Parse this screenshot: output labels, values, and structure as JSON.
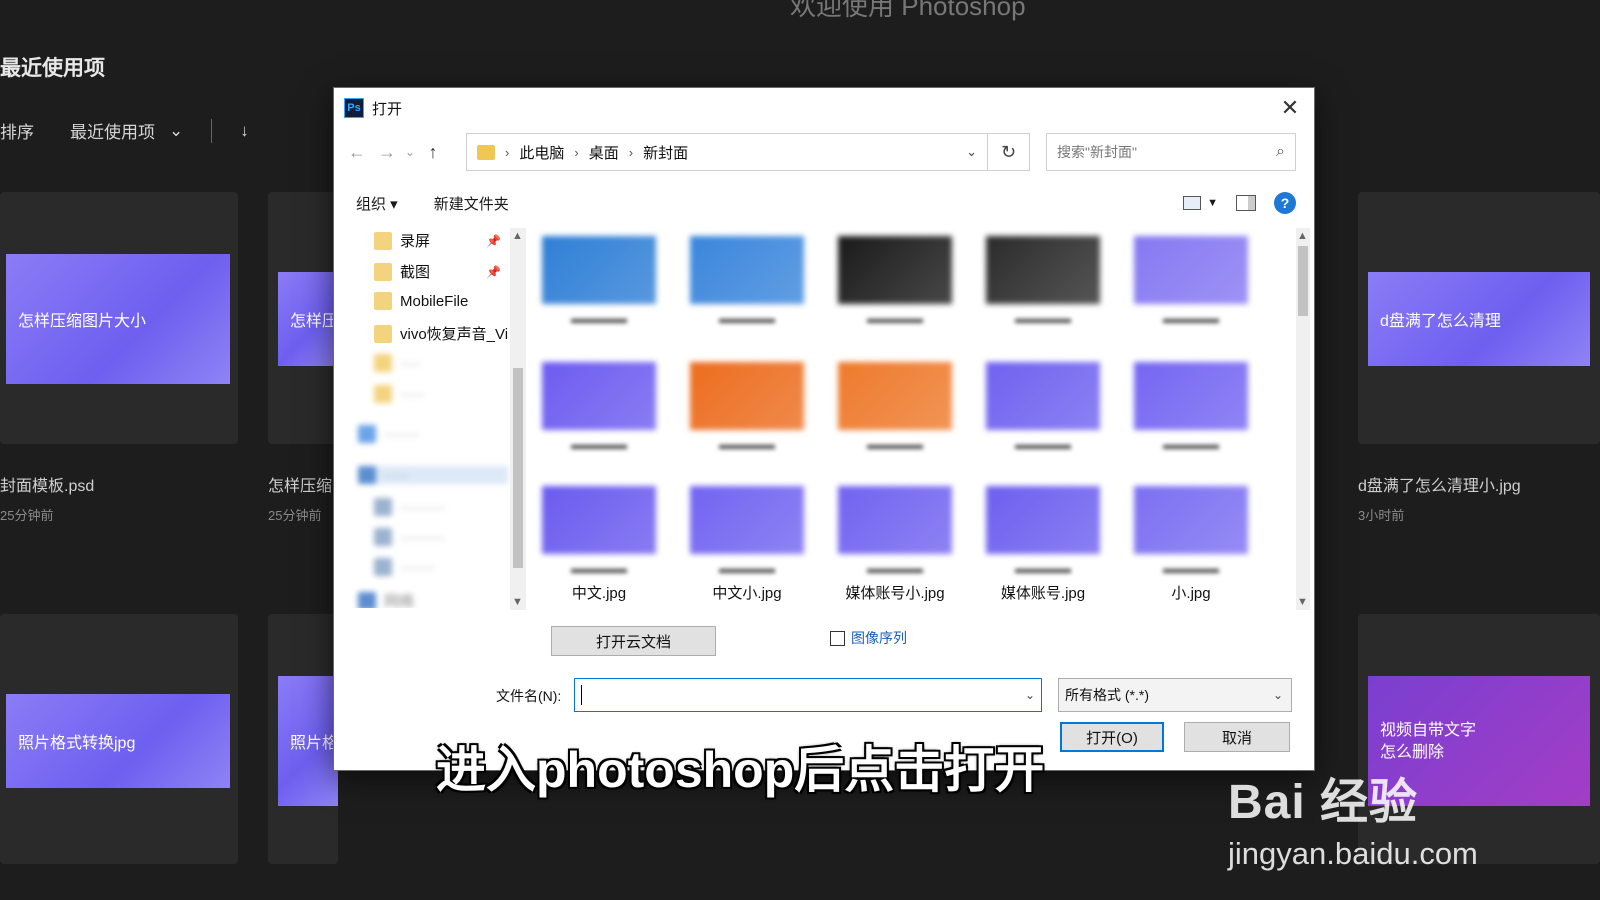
{
  "background": {
    "top_title": "欢迎使用 Photoshop",
    "section_title": "最近使用项",
    "sort_label": "排序",
    "sort_value": "最近使用项",
    "cards": [
      {
        "thumb_text": "怎样压缩图片大小",
        "name": "封面模板.psd",
        "time": "25分钟前"
      },
      {
        "thumb_text": "怎样压",
        "name": "怎样压缩",
        "time": "25分钟前"
      },
      {
        "thumb_text": "d盘满了怎么清理",
        "name": "d盘满了怎么清理小.jpg",
        "time": "3小时前"
      },
      {
        "thumb_text": "照片格式转换jpg"
      },
      {
        "thumb_text": "照片格"
      },
      {
        "thumb_text": "视频自带文字怎么删除"
      }
    ]
  },
  "dialog": {
    "title": "打开",
    "app_icon": "Ps",
    "close": "✕",
    "breadcrumb": [
      "此电脑",
      "桌面",
      "新封面"
    ],
    "search_placeholder": "搜索\"新封面\"",
    "toolbar": {
      "organize": "组织 ▾",
      "new_folder": "新建文件夹",
      "help": "?"
    },
    "tree": [
      {
        "label": "录屏",
        "pinned": true
      },
      {
        "label": "截图",
        "pinned": true
      },
      {
        "label": "MobileFile"
      },
      {
        "label": "vivo恢复声音_Vi"
      },
      {
        "label": "····",
        "blurred": true
      },
      {
        "label": "·····",
        "blurred": true
      },
      {
        "label": "·······",
        "blurred": true
      },
      {
        "label": "·····",
        "blurred": true
      },
      {
        "label": "·········",
        "blurred": true
      },
      {
        "label": "·········",
        "blurred": true
      },
      {
        "label": "·······",
        "blurred": true
      },
      {
        "label": "网络",
        "blurred": true
      }
    ],
    "files": [
      {
        "name": "",
        "color": "#2f7fd6"
      },
      {
        "name": "",
        "color": "#3a86dc"
      },
      {
        "name": "",
        "color": "#1a1a1a"
      },
      {
        "name": "",
        "color": "#2b2b2b"
      },
      {
        "name": "",
        "color": "#8678f2"
      },
      {
        "name": "",
        "color": "#6d5cf0"
      },
      {
        "name": "",
        "color": "#ec6d1f"
      },
      {
        "name": "",
        "color": "#ee7a2c"
      },
      {
        "name": "",
        "color": "#7062f0"
      },
      {
        "name": "",
        "color": "#7566f2"
      },
      {
        "name": "中文.jpg",
        "color": "#6b5bef"
      },
      {
        "name": "中文小.jpg",
        "color": "#7264f1"
      },
      {
        "name": "媒体账号小.jpg",
        "color": "#7263f0"
      },
      {
        "name": "媒体账号.jpg",
        "color": "#6e5fef"
      },
      {
        "name": "小.jpg",
        "color": "#7c6ff2"
      }
    ],
    "cloud_button": "打开云文档",
    "image_sequence": "图像序列",
    "filename_label": "文件名(N):",
    "filename_value": "",
    "filetype": "所有格式 (*.*)",
    "open_button": "打开(O)",
    "cancel_button": "取消"
  },
  "overlay": {
    "subtitle": "进入photoshop后点击打开",
    "watermark": "Bai 经验",
    "watermark_url": "jingyan.baidu.com"
  }
}
